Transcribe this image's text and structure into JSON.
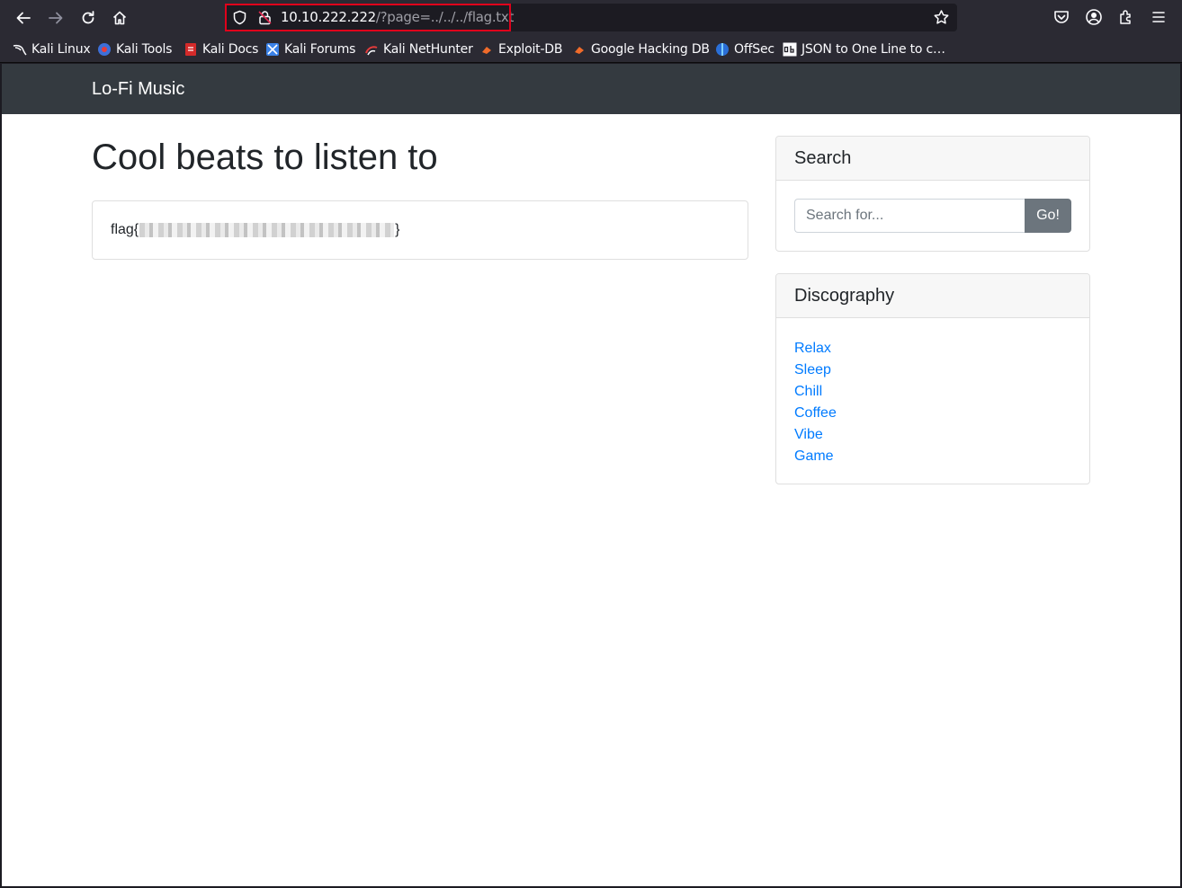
{
  "browser": {
    "url_host": "10.10.222.222",
    "url_path": "/?page=../../../flag.txt",
    "bookmarks": [
      {
        "label": "Kali Linux",
        "icon": "kali-dragon-icon"
      },
      {
        "label": "Kali Tools",
        "icon": "kali-tools-icon"
      },
      {
        "label": "Kali Docs",
        "icon": "kali-docs-icon"
      },
      {
        "label": "Kali Forums",
        "icon": "kali-forums-icon"
      },
      {
        "label": "Kali NetHunter",
        "icon": "kali-nethunter-icon"
      },
      {
        "label": "Exploit-DB",
        "icon": "exploit-db-icon"
      },
      {
        "label": "Google Hacking DB",
        "icon": "ghdb-icon"
      },
      {
        "label": "OffSec",
        "icon": "offsec-icon"
      },
      {
        "label": "JSON to One Line to c…",
        "icon": "cb-icon"
      }
    ],
    "highlight_color": "#e0001b"
  },
  "site": {
    "brand": "Lo-Fi Music",
    "heading": "Cool beats to listen to",
    "flag_prefix": "flag{",
    "flag_suffix": "}",
    "search": {
      "title": "Search",
      "placeholder": "Search for...",
      "button": "Go!"
    },
    "discography": {
      "title": "Discography",
      "links": [
        "Relax",
        "Sleep",
        "Chill",
        "Coffee",
        "Vibe",
        "Game"
      ]
    },
    "colors": {
      "navbar": "#343a40",
      "link": "#007bff",
      "button": "#6c757d"
    }
  }
}
